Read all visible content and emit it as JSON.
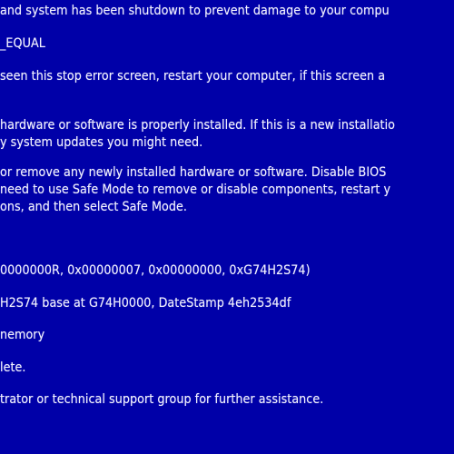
{
  "screen": {
    "background_color": "#0000a8",
    "text_color": "#f0f0ff",
    "lines": [
      " and system has been shutdown to prevent damage to your compu",
      "_EQUAL",
      " seen this stop error screen, restart your computer,  if this screen a",
      " hardware or software is properly installed. If this is a new installatio",
      "y system updates you might need.",
      " or remove any newly installed hardware or software. Disable BIOS",
      " need to use Safe Mode to remove or disable components, restart y",
      "ons, and then select Safe Mode.",
      "0000000R, 0x00000007, 0x00000000, 0xG74H2S74)",
      "H2S74 base at G74H0000, DateStamp 4eh2534df",
      "nemory",
      "lete.",
      "trator or technical support group for further assistance."
    ]
  }
}
